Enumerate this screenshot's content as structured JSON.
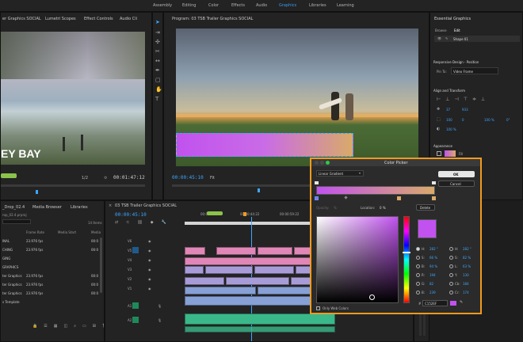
{
  "workspaces": [
    "Assembly",
    "Editing",
    "Color",
    "Effects",
    "Audio",
    "Graphics",
    "Libraries",
    "Learning"
  ],
  "active_workspace": "Graphics",
  "source_panel": {
    "tabs": [
      "er Graphics SOCIAL",
      "Lumetri Scopes",
      "Effect Controls",
      "Audio Cli"
    ],
    "overlay_text": "EY BAY",
    "timecode": "00:01:47:12",
    "fraction": "1/2"
  },
  "program_panel": {
    "title": "Program: 03 TSB Trailer Graphics SOCIAL",
    "timecode": "00:00:45:10",
    "zoom": "Fit"
  },
  "essential_graphics": {
    "title": "Essential Graphics",
    "tabs": [
      "Browse",
      "Edit"
    ],
    "layer_name": "Shape 01",
    "responsive_heading": "Responsive Design - Position",
    "pin_label": "Pin To:",
    "pin_value": "Video Frame",
    "align_heading": "Align and Transform",
    "pos_x": "37",
    "pos_y": "933",
    "scale_a": "100",
    "scale_b": "0",
    "scale_pct": "100 %",
    "rotation": "0°",
    "opacity": "100 %",
    "appearance_heading": "Appearance",
    "fill_label": "Fill"
  },
  "project_panel": {
    "tabs": [
      "_Drop_02.4",
      "Media Browser",
      "Libraries"
    ],
    "project_file": "rop_02.4.prproj",
    "items_count": "14 Items",
    "columns": [
      "Frame Rate",
      "Media Start",
      "Media"
    ],
    "rows": [
      {
        "name": "INAL",
        "fps": "23.976 fps",
        "start": "00:0"
      },
      {
        "name": "CHING",
        "fps": "23.976 fps",
        "start": "00:0"
      },
      {
        "name": "GING",
        "fps": "",
        "start": ""
      },
      {
        "name": "GRAPHICS",
        "fps": "",
        "start": ""
      },
      {
        "name": "ter Graphics",
        "fps": "23.976 fps",
        "start": "00:0"
      },
      {
        "name": "ter Graphics",
        "fps": "23.976 fps",
        "start": "00:0"
      },
      {
        "name": "ter Graphics",
        "fps": "23.976 fps",
        "start": "00:0"
      },
      {
        "name": "s Template",
        "fps": "",
        "start": ""
      }
    ]
  },
  "timeline": {
    "title": "03 TSB Trailer Graphics SOCIAL",
    "timecode": "00:00:45:10",
    "ruler": [
      "00:00:29:23",
      "00:00:44:22",
      "00:00:59:22"
    ],
    "tracks_video": [
      "V6",
      "V5",
      "V4",
      "V3",
      "V2",
      "V1"
    ],
    "tracks_audio": [
      "A1",
      "A2"
    ]
  },
  "color_picker": {
    "title": "Color Picker",
    "mode": "Linear Gradient",
    "ok_label": "OK",
    "cancel_label": "Cancel",
    "opacity_label": "Opacity:",
    "opacity_value": "%",
    "location_label": "Location:",
    "location_value": "0 %",
    "delete_label": "Delete",
    "only_web_label": "Only Web Colors",
    "hex": "C152EF",
    "fields_left": [
      {
        "label": "H:",
        "value": "282 °"
      },
      {
        "label": "S:",
        "value": "66 %"
      },
      {
        "label": "B:",
        "value": "94 %"
      },
      {
        "label": "R:",
        "value": "194"
      },
      {
        "label": "G:",
        "value": "82"
      },
      {
        "label": "B:",
        "value": "239"
      }
    ],
    "fields_right": [
      {
        "label": "H:",
        "value": "282 °"
      },
      {
        "label": "S:",
        "value": "82 %"
      },
      {
        "label": "L:",
        "value": "63 %"
      },
      {
        "label": "Y:",
        "value": "130"
      },
      {
        "label": "Cb:",
        "value": "184"
      },
      {
        "label": "Cr:",
        "value": "174"
      }
    ],
    "colors": {
      "selected": "#c152ef",
      "gradient_start": "#c152ef",
      "gradient_end": "#d9aa6a",
      "accent": "#f29a1e"
    }
  }
}
